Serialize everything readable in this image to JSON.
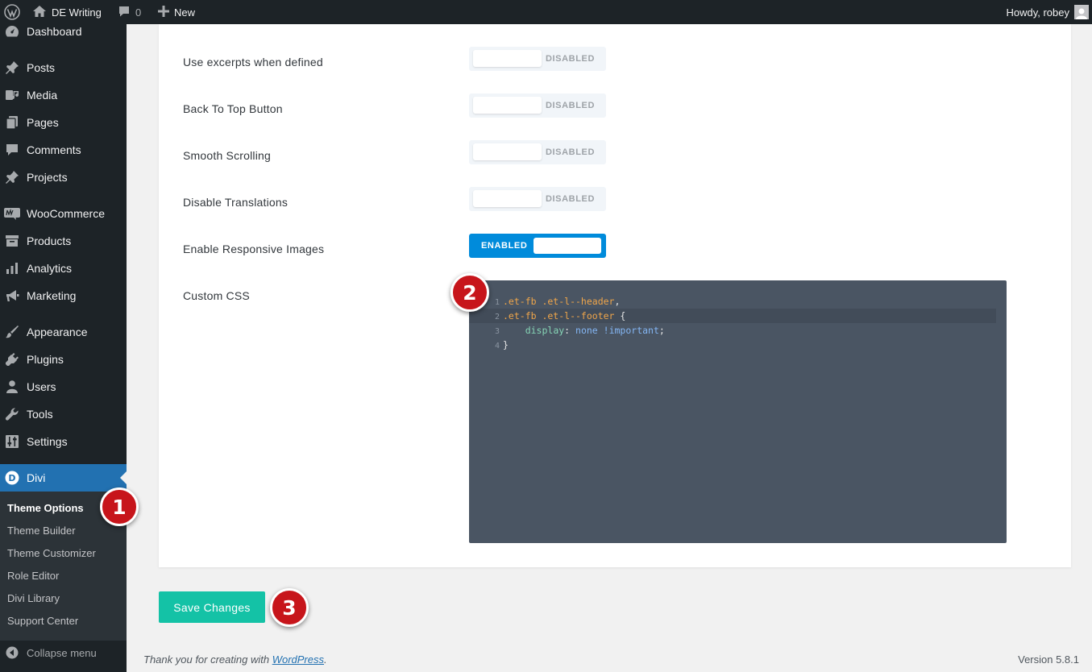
{
  "adminbar": {
    "site_name": "DE Writing",
    "comments_count": "0",
    "new_label": "New",
    "greeting": "Howdy, robey"
  },
  "sidebar": {
    "items": [
      {
        "label": "Dashboard",
        "icon": "dashboard-icon"
      },
      {
        "label": "Posts",
        "icon": "pin-icon"
      },
      {
        "label": "Media",
        "icon": "media-icon"
      },
      {
        "label": "Pages",
        "icon": "pages-icon"
      },
      {
        "label": "Comments",
        "icon": "comment-icon"
      },
      {
        "label": "Projects",
        "icon": "pin-icon"
      },
      {
        "label": "WooCommerce",
        "icon": "woo-icon"
      },
      {
        "label": "Products",
        "icon": "archive-icon"
      },
      {
        "label": "Analytics",
        "icon": "bar-chart-icon"
      },
      {
        "label": "Marketing",
        "icon": "megaphone-icon"
      },
      {
        "label": "Appearance",
        "icon": "brush-icon"
      },
      {
        "label": "Plugins",
        "icon": "plug-icon"
      },
      {
        "label": "Users",
        "icon": "user-icon"
      },
      {
        "label": "Tools",
        "icon": "wrench-icon"
      },
      {
        "label": "Settings",
        "icon": "sliders-icon"
      },
      {
        "label": "Divi",
        "icon": "divi-icon"
      }
    ],
    "submenu": [
      "Theme Options",
      "Theme Builder",
      "Theme Customizer",
      "Role Editor",
      "Divi Library",
      "Support Center"
    ],
    "collapse_label": "Collapse menu"
  },
  "options": [
    {
      "label": "Use excerpts when defined",
      "state": "DISABLED"
    },
    {
      "label": "Back To Top Button",
      "state": "DISABLED"
    },
    {
      "label": "Smooth Scrolling",
      "state": "DISABLED"
    },
    {
      "label": "Disable Translations",
      "state": "DISABLED"
    },
    {
      "label": "Enable Responsive Images",
      "state": "ENABLED"
    }
  ],
  "custom_css": {
    "label": "Custom CSS",
    "line_numbers": [
      "1",
      "2",
      "3",
      "4"
    ],
    "line1_selector": ".et-fb .et-l--header",
    "line1_comma": ",",
    "line2_selector": ".et-fb .et-l--footer",
    "line2_brace": " {",
    "line3_indent": "    ",
    "line3_property": "display",
    "line3_colon": ": ",
    "line3_value": "none !important",
    "line3_semicolon": ";",
    "line4_brace": "}"
  },
  "badges": [
    "1",
    "2",
    "3"
  ],
  "save_label": "Save Changes",
  "footer": {
    "thanks_prefix": "Thank you for creating with ",
    "link_text": "WordPress",
    "thanks_suffix": ".",
    "version": "Version 5.8.1"
  },
  "colors": {
    "adminbar_bg": "#1d2327",
    "menu_current": "#2271b1",
    "toggle_enabled": "#008bdb",
    "save_button": "#14c2a6",
    "badge": "#c7151b",
    "code_bg": "#4a5563"
  }
}
